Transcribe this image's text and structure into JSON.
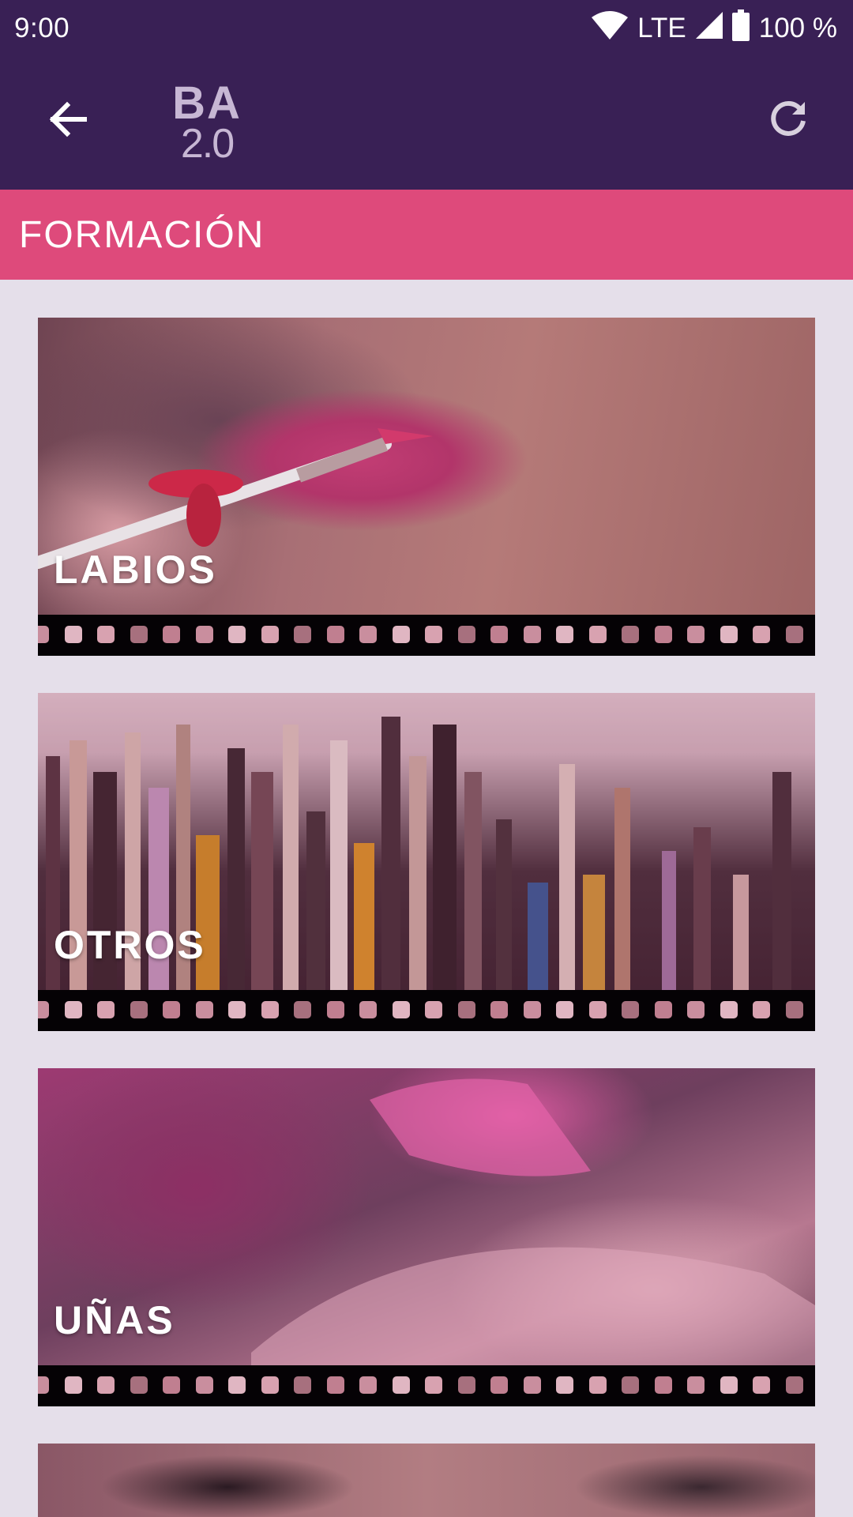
{
  "status_bar": {
    "time": "9:00",
    "network": "LTE",
    "battery": "100 %",
    "icons": [
      "wifi-icon",
      "cell-signal-icon",
      "battery-icon"
    ]
  },
  "app_bar": {
    "logo_line1": "BA",
    "logo_line2": "2.0",
    "back_icon": "arrow-left-icon",
    "refresh_icon": "refresh-icon"
  },
  "section": {
    "title": "FORMACIÓN"
  },
  "cards": [
    {
      "label": "LABIOS"
    },
    {
      "label": "OTROS"
    },
    {
      "label": "UÑAS"
    }
  ],
  "colors": {
    "app_bar": "#392055",
    "section_header": "#de4a7b",
    "background": "#e5dfea"
  }
}
